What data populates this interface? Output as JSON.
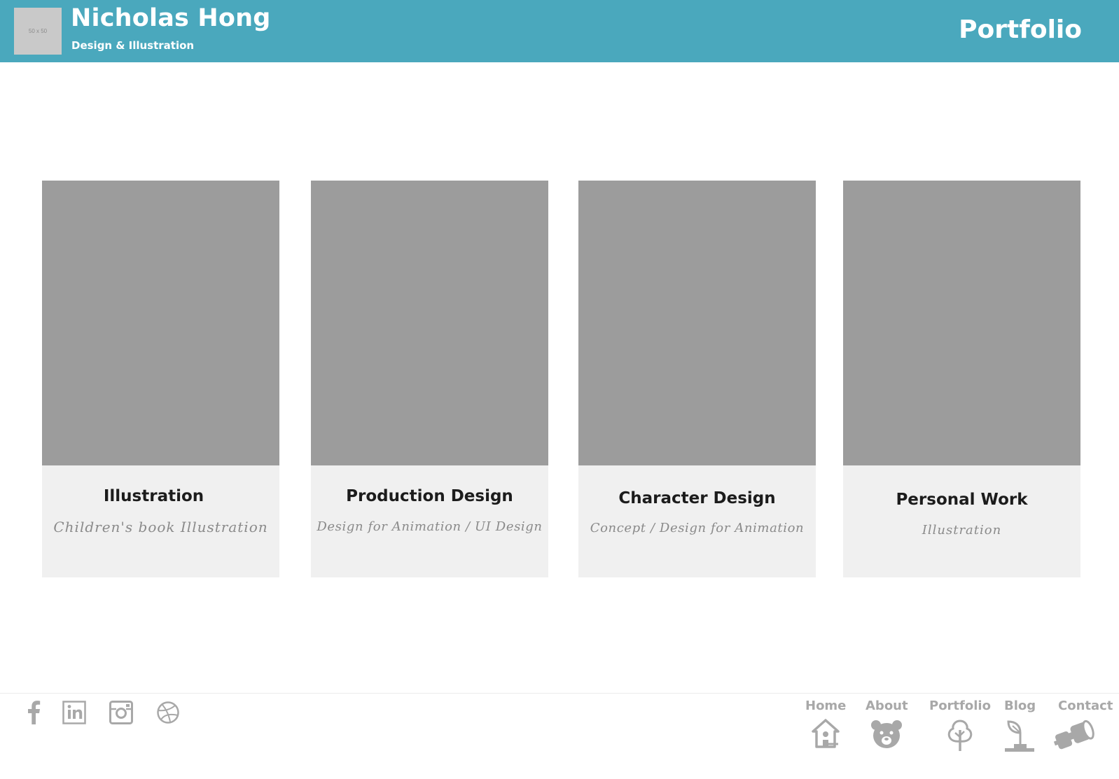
{
  "header": {
    "logo_placeholder": "50 x 50",
    "name": "Nicholas Hong",
    "tagline": "Design & Illustration",
    "page_title": "Portfolio"
  },
  "cards": [
    {
      "title": "Illustration",
      "subtitle": "Children's book Illustration"
    },
    {
      "title": "Production Design",
      "subtitle": "Design for Animation / UI Design"
    },
    {
      "title": "Character Design",
      "subtitle": "Concept / Design for Animation"
    },
    {
      "title": "Personal Work",
      "subtitle": "Illustration"
    }
  ],
  "footer": {
    "social": [
      "facebook-icon",
      "linkedin-icon",
      "instagram-icon",
      "dribbble-icon"
    ],
    "nav": [
      {
        "label": "Home",
        "icon": "birdhouse-icon"
      },
      {
        "label": "About",
        "icon": "bear-icon"
      },
      {
        "label": "Portfolio",
        "icon": "tree-icon"
      },
      {
        "label": "Blog",
        "icon": "plant-icon"
      },
      {
        "label": "Contact",
        "icon": "binoculars-icon"
      }
    ]
  },
  "colors": {
    "header_bg": "#4aa8bd",
    "placeholder_img": "#9c9c9c",
    "card_caption_bg": "#f0f0f0",
    "footer_gray": "#a8a8a8"
  }
}
